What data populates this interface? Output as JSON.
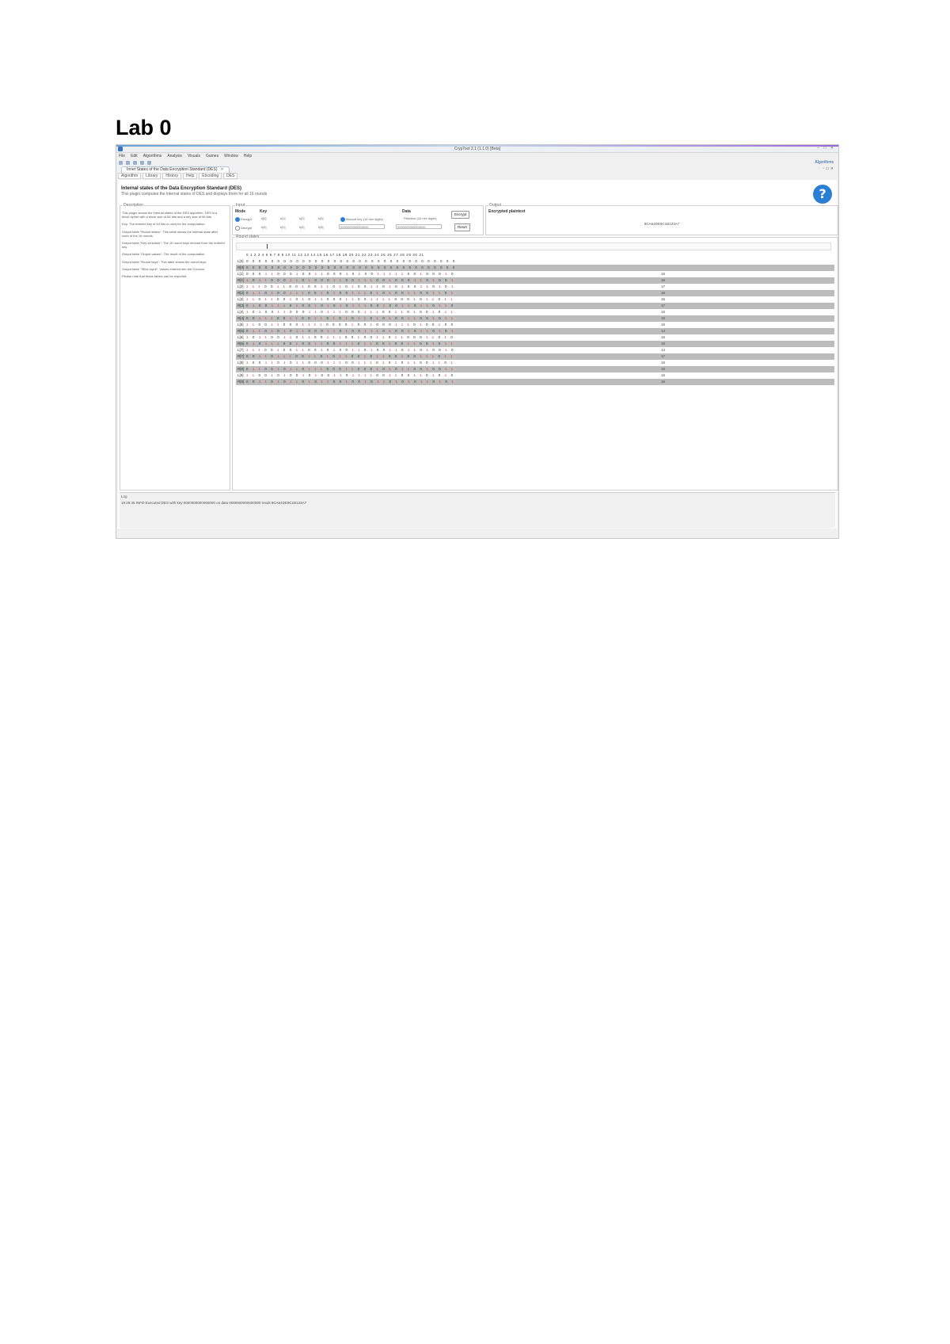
{
  "document": {
    "title": "Lab 0"
  },
  "window": {
    "title": "CrypTool 2.1 (1.1.0) [Beta]",
    "controls": "–  □  ✕"
  },
  "menu": [
    "File",
    "Edit",
    "Algorithms",
    "Analysis",
    "Visuals",
    "Games",
    "Window",
    "Help"
  ],
  "toolbar": {
    "right_label": "Algorithms"
  },
  "editor_tab": {
    "label": "Inner States of the Data Encryption Standard (DES)"
  },
  "views_label": "▫ ▭ ✕",
  "subtabs": [
    "Algorithm",
    "Library",
    "History",
    "Help",
    "Encoding",
    "DES"
  ],
  "plugin": {
    "title": "Internal states of the Data Encryption Standard (DES)",
    "subtitle": "This plugin computes the internal states of DES and displays them for all 16 rounds",
    "help_glyph": "?"
  },
  "description": {
    "label": "Description",
    "paragraphs": [
      "This plugin shows the internal states of the DES algorithm. DES is a block cipher with a block size of 64 bits and a key size of 56 bits.",
      "Key: The entered key of 64 bits is used for the computation.",
      "Output table \"Round states\": This table shows the internal state after each of the 16 rounds.",
      "Output table \"Key schedule\": The 16 round keys derived from the entered key.",
      "Output table \"Output values\": The result of the computation.",
      "Output table \"Round keys\": This table shows the round keys.",
      "Output table \"SBox input\": Values entered into the S-boxes.",
      "Please note that these tables can be exported."
    ]
  },
  "input": {
    "label": "Input",
    "mode_header": "Mode",
    "key_header": "Key",
    "data_header": "Data",
    "mode_encrypt": "Encrypt",
    "mode_decrypt": "Decrypt",
    "key_fields": [
      "k[0]",
      "k[1]",
      "k[2]",
      "k[3]"
    ],
    "key_option": "Manual key (16 hex digits)",
    "data_option": "Plaintext (16 hex digits)",
    "key_value": "0000000000000000",
    "data_value": "0000000000000000",
    "encrypt_button": "Encrypt",
    "reset_button": "Reset"
  },
  "output": {
    "label": "Output",
    "encrypted_label": "Encrypted plaintext",
    "value": "8CA64DE9C1B123A7"
  },
  "round_table": {
    "label": "Round states",
    "header": "0 1 2 3 4 5 6 7 8 9 10 11 12 13 14 15 16 17 18 19 20 21 22 23 24 25 26 27 28 29 30 31",
    "rows": [
      {
        "label": "L[0]",
        "cells": "0000000000000000000000000000000000",
        "shade": false,
        "check": ""
      },
      {
        "label": "R[0]",
        "cells": "0000000000000000000000000000000000",
        "shade": true,
        "check": ""
      },
      {
        "label": "L[1]",
        "cells": "0001100010011000101001111100100010",
        "shade": false,
        "check": "16"
      },
      {
        "label": "R[1]",
        "cells": "1011000110100011001110010001101001",
        "shade": true,
        "check": "16"
      },
      {
        "label": "L[2]",
        "cells": "1110011001001101010011010100110101",
        "shade": false,
        "check": "17"
      },
      {
        "label": "R[2]",
        "cells": "0110100111001010011101010011001101",
        "shade": true,
        "check": "16"
      },
      {
        "label": "L[3]",
        "cells": "1101100101011000110011110001011011",
        "shade": false,
        "check": "15"
      },
      {
        "label": "R[3]",
        "cells": "0100111010010101011100100110110110",
        "shade": true,
        "check": "17"
      },
      {
        "label": "L[4]",
        "cells": "1010011000110111000111001101001011",
        "shade": false,
        "check": "16"
      },
      {
        "label": "R[4]",
        "cells": "0011100110011010101101010011001011",
        "shade": true,
        "check": "15"
      },
      {
        "label": "L[5]",
        "cells": "1100110001111000010010001110100100",
        "shade": false,
        "check": "16"
      },
      {
        "label": "R[5]",
        "cells": "0110101011000110100111010010110101",
        "shade": true,
        "check": "14"
      },
      {
        "label": "L[6]",
        "cells": "1011001101100111001001101100011010",
        "shade": false,
        "check": "16"
      },
      {
        "label": "R[6]",
        "cells": "0101110010011001110110010011001011",
        "shade": true,
        "check": "15"
      },
      {
        "label": "L[7]",
        "cells": "1110010011001010011010011011010010",
        "shade": false,
        "check": "14"
      },
      {
        "label": "R[7]",
        "cells": "0011011100110101100101100100111011",
        "shade": true,
        "check": "17"
      },
      {
        "label": "L[8]",
        "cells": "1001101011000111001110101011001101",
        "shade": false,
        "check": "16"
      },
      {
        "label": "R[8]",
        "cells": "0110010110111000110001010110010011",
        "shade": true,
        "check": "15"
      },
      {
        "label": "L[9]",
        "cells": "1100101001010011011110011001101010",
        "shade": false,
        "check": "16"
      },
      {
        "label": "R[9]",
        "cells": "0011010110101100100101101010110101",
        "shade": true,
        "check": "16"
      }
    ]
  },
  "console": {
    "label": "Log",
    "line": "18:29:45  INFO  Executed DES with key 0000000000000000 on data 0000000000000000  result 8CA64DE9C1B123A7"
  }
}
